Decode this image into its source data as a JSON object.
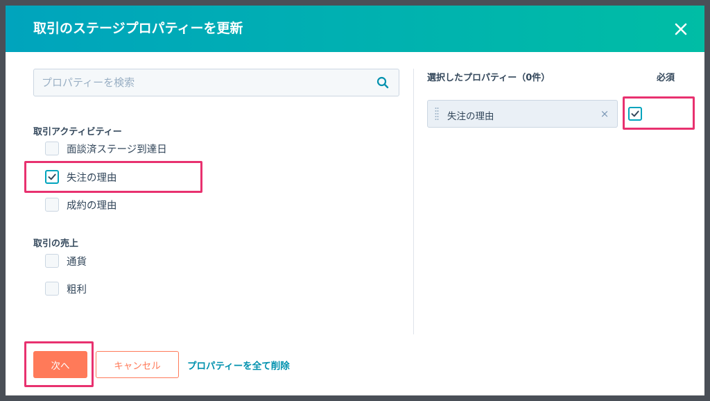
{
  "modal": {
    "title": "取引のステージプロパティーを更新",
    "close_icon": "close-icon"
  },
  "search": {
    "placeholder": "プロパティーを検索",
    "value": "",
    "icon": "search-icon"
  },
  "groups": [
    {
      "title": "取引アクティビティー",
      "options": [
        {
          "label": "面談済ステージ到達日",
          "checked": false
        },
        {
          "label": "失注の理由",
          "checked": true
        },
        {
          "label": "成約の理由",
          "checked": false
        }
      ]
    },
    {
      "title": "取引の売上",
      "options": [
        {
          "label": "通貨",
          "checked": false
        },
        {
          "label": "粗利",
          "checked": false
        }
      ]
    }
  ],
  "selected": {
    "header": "選択したプロパティー（0件）",
    "required_header": "必須",
    "items": [
      {
        "label": "失注の理由",
        "remove": "×",
        "required": true
      }
    ]
  },
  "footer": {
    "next_label": "次へ",
    "cancel_label": "キャンセル",
    "remove_all_label": "プロパティーを全て削除"
  },
  "colors": {
    "header_start": "#00a4bd",
    "header_end": "#00bda5",
    "primary_button": "#ff7a59",
    "link": "#0091ae",
    "highlight": "#e8316f",
    "checkbox_accent": "#00a4bd"
  }
}
